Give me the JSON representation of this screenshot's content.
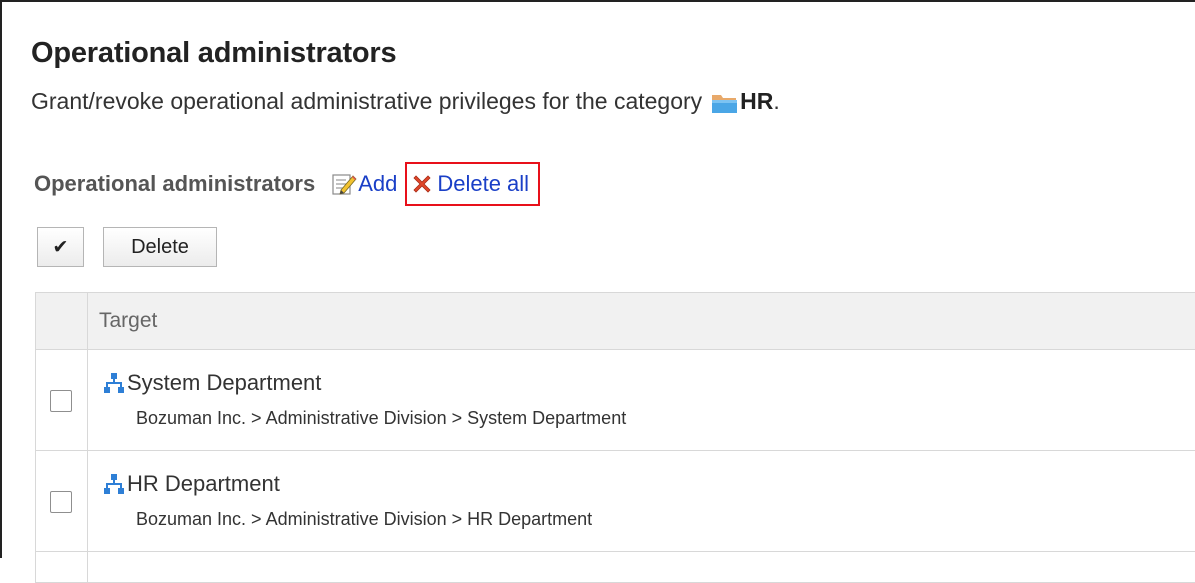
{
  "header": {
    "title": "Operational administrators",
    "description_prefix": "Grant/revoke operational administrative privileges for the category",
    "category_name": "HR",
    "description_suffix": "."
  },
  "section": {
    "title": "Operational administrators",
    "add_label": "Add",
    "delete_all_label": "Delete all"
  },
  "toolbar": {
    "select_all_label": "✔",
    "delete_label": "Delete"
  },
  "table": {
    "column_header": "Target",
    "rows": [
      {
        "name": "System Department",
        "path": "Bozuman Inc. > Administrative Division > System Department",
        "checked": false
      },
      {
        "name": "HR Department",
        "path": "Bozuman Inc. > Administrative Division > HR Department",
        "checked": false
      }
    ]
  },
  "colors": {
    "link": "#1a3fc7",
    "highlight_box": "#e8101a",
    "header_bg": "#f1f1f1",
    "org_icon": "#2e7fd6"
  },
  "icons": {
    "folder": "folder-icon",
    "add": "edit-add-icon",
    "delete_all": "red-x-icon",
    "org": "organization-icon"
  }
}
